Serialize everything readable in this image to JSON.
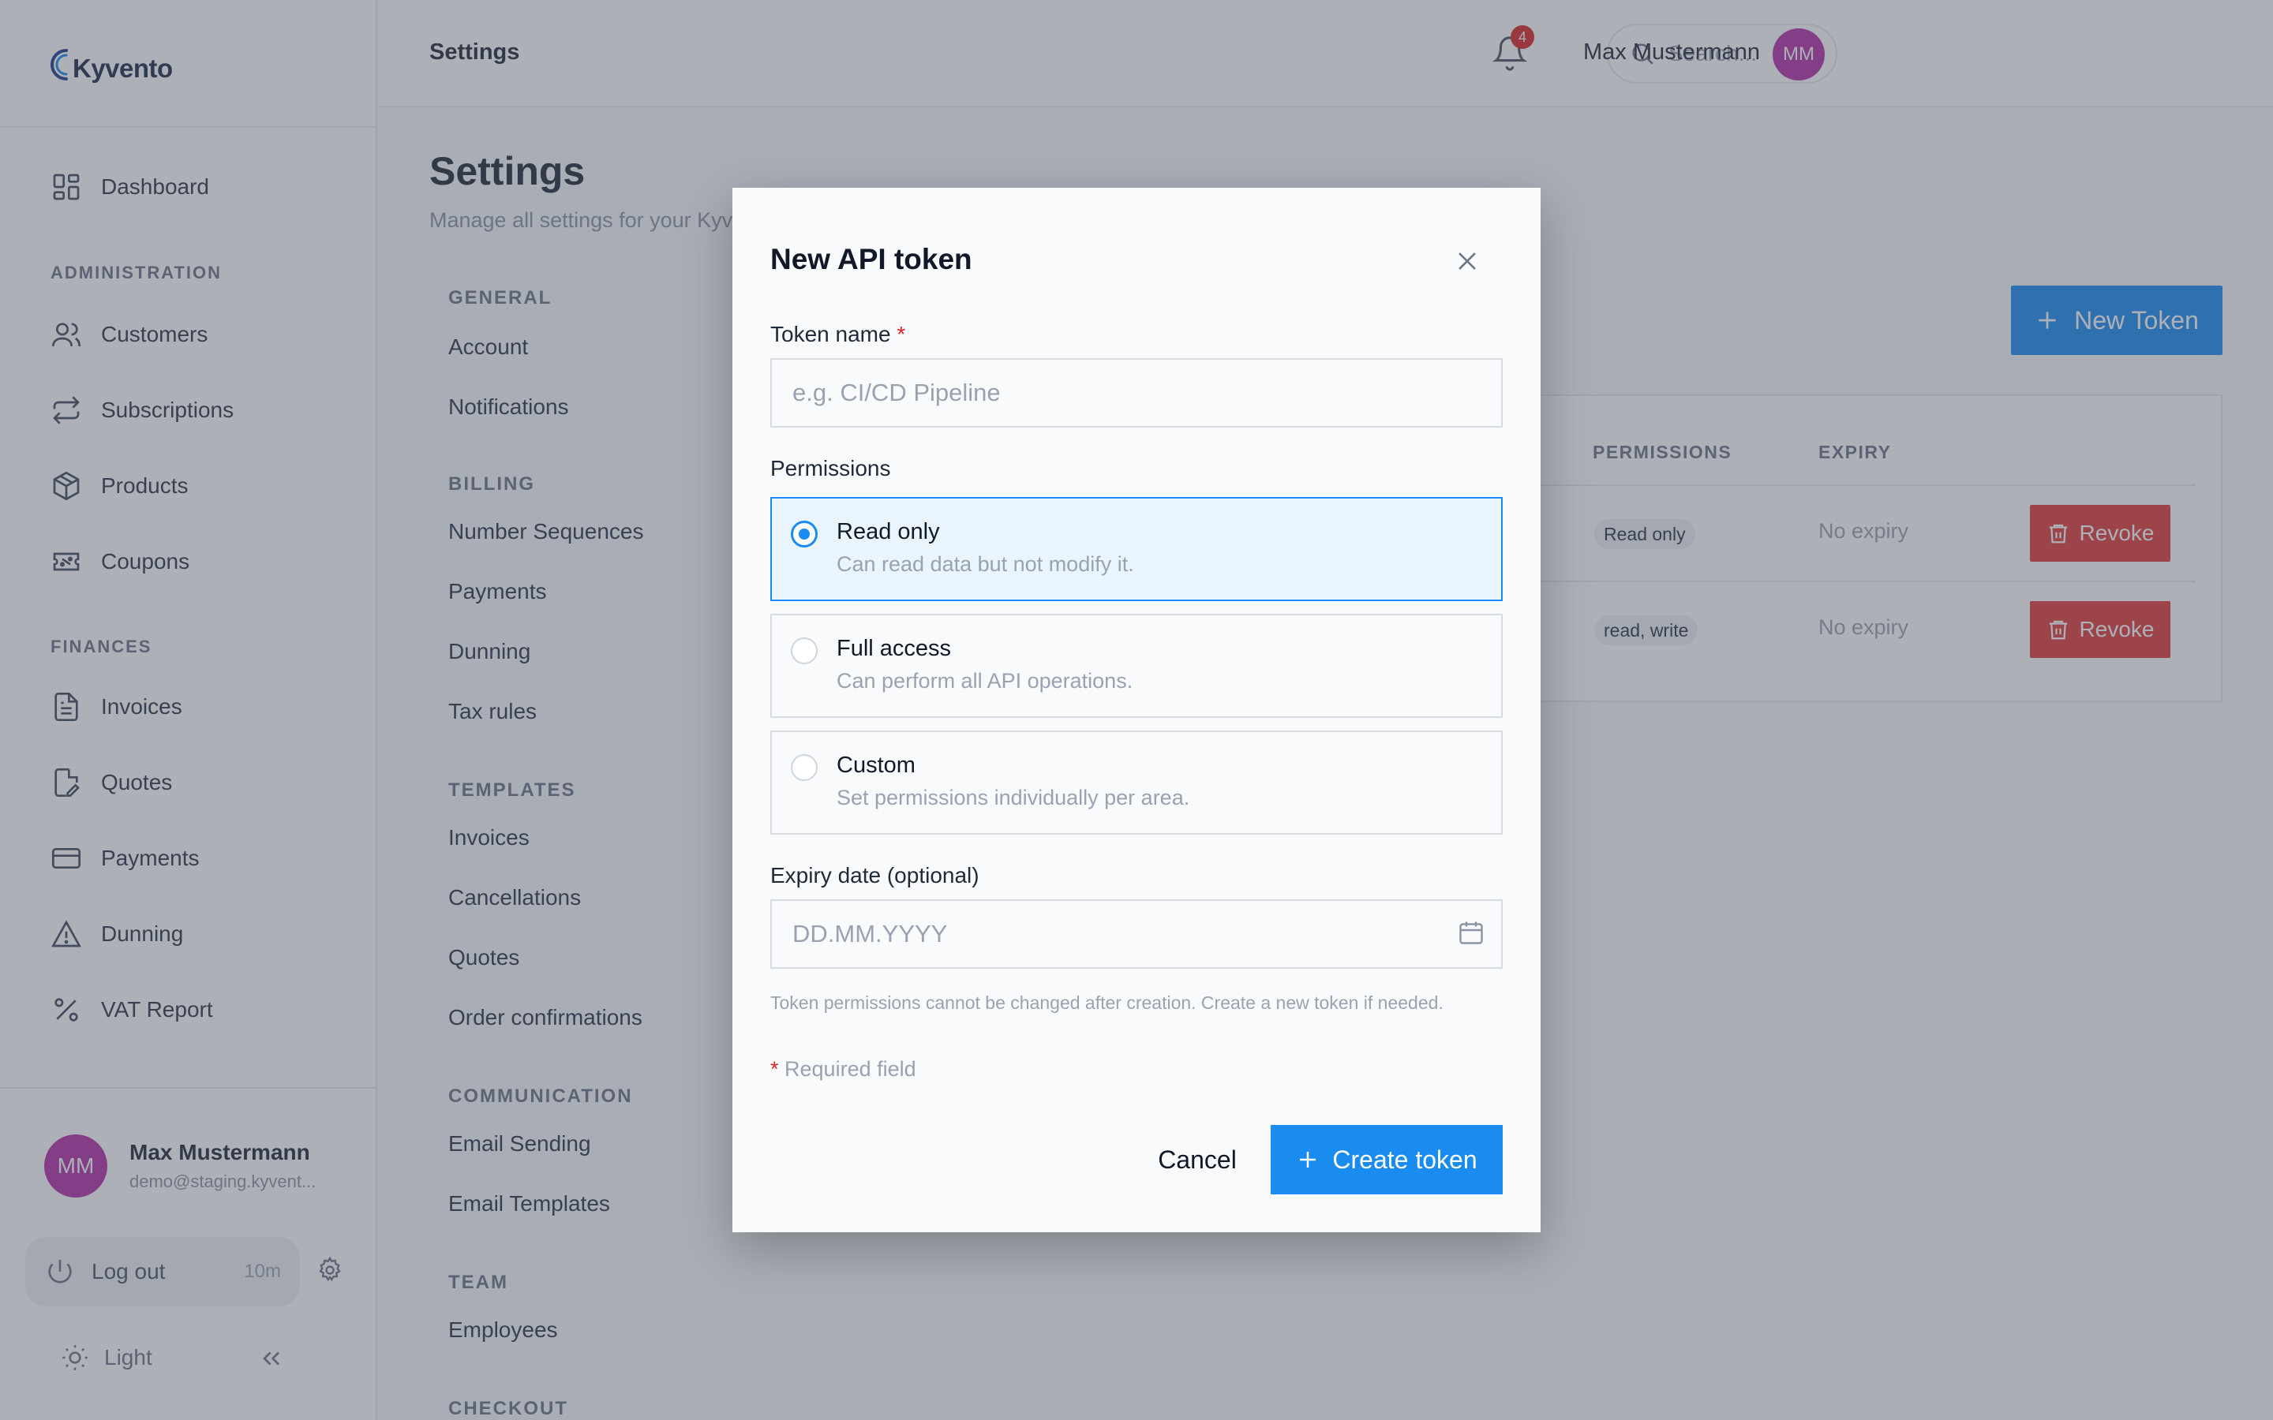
{
  "brand": {
    "name": "Kyvento"
  },
  "sidebar": {
    "dashboard": "Dashboard",
    "sections": [
      "ADMINISTRATION",
      "FINANCES"
    ],
    "admin_items": [
      "Customers",
      "Subscriptions",
      "Products",
      "Coupons"
    ],
    "finance_items": [
      "Invoices",
      "Quotes",
      "Payments",
      "Dunning",
      "VAT Report"
    ],
    "user": {
      "initials": "MM",
      "name": "Max Mustermann",
      "email": "demo@staging.kyvent..."
    },
    "logout": {
      "label": "Log out",
      "time": "10m"
    },
    "theme": "Light"
  },
  "topbar": {
    "title": "Settings",
    "search_placeholder": "Search...",
    "search_shortcut": "⌘K",
    "notification_count": "4",
    "user_name": "Max Mustermann",
    "user_initials": "MM"
  },
  "page": {
    "title": "Settings",
    "subtitle": "Manage all settings for your Kyv"
  },
  "settings_nav": {
    "general": {
      "title": "GENERAL",
      "items": [
        "Account",
        "Notifications"
      ]
    },
    "billing": {
      "title": "BILLING",
      "items": [
        "Number Sequences",
        "Payments",
        "Dunning",
        "Tax rules"
      ]
    },
    "templates": {
      "title": "TEMPLATES",
      "items": [
        "Invoices",
        "Cancellations",
        "Quotes",
        "Order confirmations"
      ]
    },
    "communication": {
      "title": "COMMUNICATION",
      "items": [
        "Email Sending",
        "Email Templates"
      ]
    },
    "team": {
      "title": "TEAM",
      "items": [
        "Employees"
      ]
    },
    "checkout": {
      "title": "CHECKOUT"
    }
  },
  "tokens": {
    "new_button": "New Token",
    "columns": [
      "PERMISSIONS",
      "EXPIRY"
    ],
    "rows": [
      {
        "permissions": "Read only",
        "expiry": "No expiry",
        "action": "Revoke"
      },
      {
        "permissions": "read, write",
        "expiry": "No expiry",
        "action": "Revoke"
      }
    ]
  },
  "modal": {
    "title": "New API token",
    "token_name_label": "Token name",
    "required_mark": "*",
    "token_name_placeholder": "e.g. CI/CD Pipeline",
    "permissions_label": "Permissions",
    "options": [
      {
        "title": "Read only",
        "desc": "Can read data but not modify it.",
        "selected": true
      },
      {
        "title": "Full access",
        "desc": "Can perform all API operations.",
        "selected": false
      },
      {
        "title": "Custom",
        "desc": "Set permissions individually per area.",
        "selected": false
      }
    ],
    "expiry_label": "Expiry date (optional)",
    "expiry_placeholder": "DD.MM.YYYY",
    "hint": "Token permissions cannot be changed after creation. Create a new token if needed.",
    "required_note": "Required field",
    "cancel": "Cancel",
    "create": "Create token"
  },
  "colors": {
    "accent": "#1a8cf0",
    "danger": "#e23a3a",
    "avatar": "#b231a8"
  }
}
